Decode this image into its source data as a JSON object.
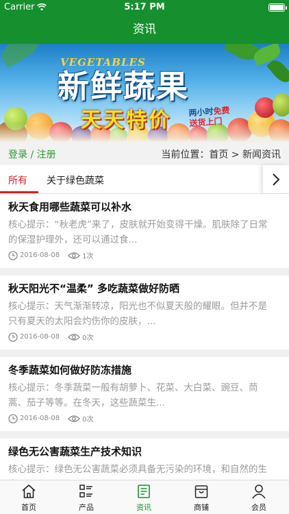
{
  "status_bar": {
    "carrier": "Carrier",
    "time": "5:17 PM"
  },
  "nav": {
    "title": "资讯"
  },
  "banner": {
    "english": "VEGETABLES",
    "title": "新鲜蔬果",
    "subtitle": "天天特价",
    "tag_line1_a": "两小时",
    "tag_line1_b": "免费",
    "tag_line2": "送货上门"
  },
  "crumb": {
    "login_link": "登录 / 注册",
    "location": "当前位置：首页 > 新闻资讯"
  },
  "tabs": [
    {
      "label": "所有",
      "active": true
    },
    {
      "label": "关于绿色蔬菜",
      "active": false
    }
  ],
  "articles": [
    {
      "title": "秋天食用哪些蔬菜可以补水",
      "summary": "核心提示：“秋老虎”来了，皮肤就开始变得干燥。肌肤除了日常的保湿护理外，还可以通过食...",
      "date": "2016-08-08",
      "views": "1次"
    },
    {
      "title": "秋天阳光不“温柔” 多吃蔬菜做好防晒",
      "summary": "核心提示：天气渐渐转凉，阳光也不似夏天般的耀眼。但并不是只有夏天的太阳会灼伤你的皮肤，...",
      "date": "2016-08-08",
      "views": "0次"
    },
    {
      "title": "冬季蔬菜如何做好防冻措施",
      "summary": "核心提示：冬季蔬菜一般有胡萝卜、花菜、大白菜、豌豆、茼蒿、茄子等等。在冬天，这些蔬菜生...",
      "date": "2016-08-08",
      "views": "0次"
    },
    {
      "title": "绿色无公害蔬菜生产技术知识",
      "summary": "核心提示：绿色无公害蔬菜必须具备无污染的环境，和自然的生态...",
      "date": "",
      "views": ""
    }
  ],
  "tab_bar": [
    {
      "label": "首页",
      "icon": "home-icon"
    },
    {
      "label": "产品",
      "icon": "list-icon"
    },
    {
      "label": "资讯",
      "icon": "news-icon",
      "active": true
    },
    {
      "label": "商铺",
      "icon": "shop-icon"
    },
    {
      "label": "会员",
      "icon": "user-icon"
    }
  ],
  "colors": {
    "brand": "#16902e",
    "tab_active": "#d82121",
    "link": "#2b9a33"
  }
}
